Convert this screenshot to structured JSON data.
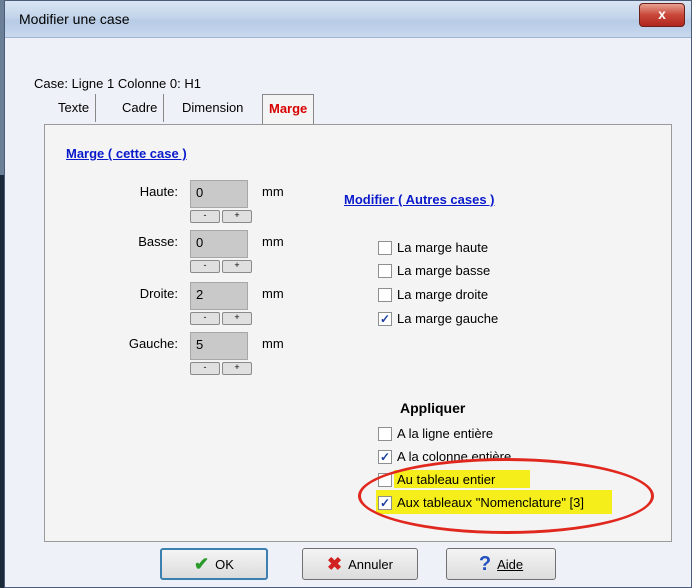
{
  "window": {
    "title": "Modifier une case",
    "close_glyph": "x"
  },
  "case_info": "Case: Ligne 1 Colonne 0: H1",
  "tabs": [
    {
      "label": "Texte",
      "active": false
    },
    {
      "label": "Cadre",
      "active": false
    },
    {
      "label": "Dimension",
      "active": false
    },
    {
      "label": "Marge",
      "active": true
    }
  ],
  "margin_section": {
    "title": "Marge ( cette case )",
    "fields": [
      {
        "label": "Haute:",
        "value": "0",
        "unit": "mm"
      },
      {
        "label": "Basse:",
        "value": "0",
        "unit": "mm"
      },
      {
        "label": "Droite:",
        "value": "2",
        "unit": "mm"
      },
      {
        "label": "Gauche:",
        "value": "5",
        "unit": "mm"
      }
    ],
    "stepper_minus": "-",
    "stepper_plus": "+"
  },
  "modify_section": {
    "title": "Modifier ( Autres cases )",
    "options": [
      {
        "label": "La marge haute",
        "checked": false
      },
      {
        "label": "La marge basse",
        "checked": false
      },
      {
        "label": "La marge droite",
        "checked": false
      },
      {
        "label": "La marge gauche",
        "checked": true
      }
    ]
  },
  "apply_section": {
    "title": "Appliquer",
    "options": [
      {
        "label": "A la ligne entière",
        "checked": false
      },
      {
        "label": "A la colonne entière",
        "checked": true
      },
      {
        "label": "Au tableau entier",
        "checked": false
      },
      {
        "label": "Aux tableaux \"Nomenclature\" [3]",
        "checked": true
      }
    ]
  },
  "buttons": {
    "ok": "OK",
    "cancel": "Annuler",
    "help": "Aide"
  },
  "colors": {
    "highlight": "#f5ee1a",
    "annotation_ellipse": "#e0281e",
    "link": "#0a1acb",
    "active_tab": "#d80000"
  }
}
